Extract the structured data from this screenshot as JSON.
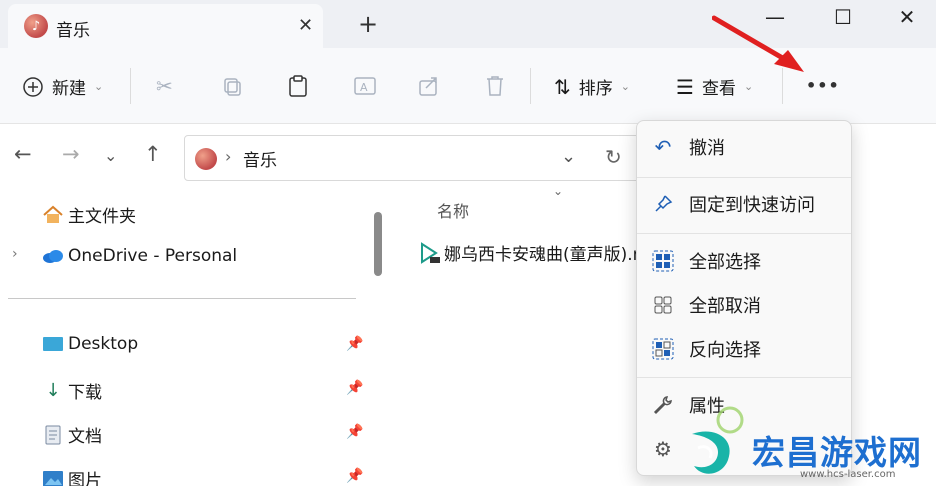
{
  "tab": {
    "title": "音乐"
  },
  "window_controls": {
    "minimize": "—",
    "maximize": "☐",
    "close": "✕"
  },
  "toolbar": {
    "new_label": "新建",
    "sort_label": "排序",
    "view_label": "查看",
    "more_label": "•••"
  },
  "address": {
    "current": "音乐"
  },
  "sidebar": {
    "home": "主文件夹",
    "onedrive": "OneDrive - Personal",
    "items": [
      {
        "label": "Desktop"
      },
      {
        "label": "下载"
      },
      {
        "label": "文档"
      },
      {
        "label": "图片"
      }
    ]
  },
  "content": {
    "column_name": "名称",
    "file_name": "娜乌西卡安魂曲(童声版).m"
  },
  "menu": {
    "items": [
      {
        "label": "撤消",
        "icon": "undo-icon"
      },
      {
        "label": "固定到快速访问",
        "icon": "pin-icon"
      },
      {
        "label": "全部选择",
        "icon": "select-all-icon"
      },
      {
        "label": "全部取消",
        "icon": "select-none-icon"
      },
      {
        "label": "反向选择",
        "icon": "invert-selection-icon"
      },
      {
        "label": "属性",
        "icon": "wrench-icon"
      },
      {
        "label": "",
        "icon": "gear-icon"
      }
    ]
  },
  "watermark": {
    "text": "宏昌游戏网",
    "url": "www.hcs-laser.com"
  },
  "colors": {
    "accent": "#1f5fb5",
    "annotation_arrow": "#e02020",
    "watermark": "#1e6fd0"
  }
}
